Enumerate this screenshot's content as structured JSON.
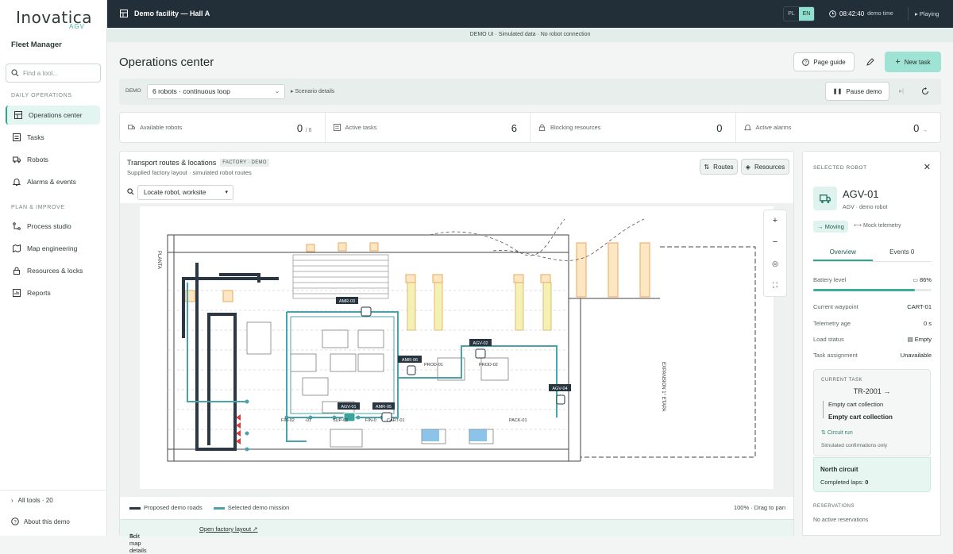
{
  "brand": {
    "name": "Inovatica",
    "sub": "AGV",
    "product": "Fleet Manager"
  },
  "sidebar": {
    "search_placeholder": "Find a tool...",
    "daily_heading": "DAILY OPERATIONS",
    "daily": [
      {
        "label": "Operations center",
        "icon": "layout-icon",
        "active": true
      },
      {
        "label": "Tasks",
        "icon": "list-icon"
      },
      {
        "label": "Robots",
        "icon": "truck-icon"
      },
      {
        "label": "Alarms & events",
        "icon": "bell-icon"
      }
    ],
    "plan_heading": "PLAN & IMPROVE",
    "plan": [
      {
        "label": "Process studio",
        "icon": "flow-icon"
      },
      {
        "label": "Map engineering",
        "icon": "map-icon"
      },
      {
        "label": "Resources & locks",
        "icon": "lock-icon"
      },
      {
        "label": "Reports",
        "icon": "chart-icon"
      }
    ],
    "all_tools": "All tools · 20",
    "about": "About this demo"
  },
  "topbar": {
    "title": "Demo facility — Hall A",
    "lang": [
      "PL",
      "EN"
    ],
    "lang_active": "EN",
    "time": "08:42:40",
    "time_label": "demo time",
    "playing": "Playing"
  },
  "banner": "DEMO UI · Simulated data · No robot connection",
  "page": {
    "title": "Operations center",
    "page_guide": "Page guide",
    "new_task": "New task"
  },
  "toolbar": {
    "demo_label": "DEMO",
    "scenario": "6 robots · continuous loop",
    "scenario_details": "Scenario details",
    "pause": "Pause demo"
  },
  "stats": [
    {
      "label": "Available robots",
      "value": "0",
      "sub": "/ 6"
    },
    {
      "label": "Active tasks",
      "value": "6",
      "sub": ""
    },
    {
      "label": "Blocking resources",
      "value": "0",
      "sub": ""
    },
    {
      "label": "Active alarms",
      "value": "0",
      "sub": "→"
    }
  ],
  "map": {
    "title": "Transport routes & locations",
    "tag": "FACTORY · DEMO",
    "subtitle": "Supplied factory layout · simulated robot routes",
    "routes_btn": "Routes",
    "resources_btn": "Resources",
    "locate": "Locate robot, worksite",
    "legend_proposed": "Proposed demo roads",
    "legend_selected": "Selected demo mission",
    "zoom": "100% · Drag to pan",
    "edit": "Edit map details",
    "open_layout": "Open factory layout ↗",
    "labels": {
      "planta": "PLANTA",
      "expansion": "EXPANSION 1° ETAPA",
      "amr03": "AMR-03",
      "amr06": "AMR-06",
      "amr05": "AMR-05",
      "agv01": "AGV-01",
      "agv02": "AGV-02",
      "agv04": "AGV-04",
      "prod01": "PROD-01",
      "prod02": "PROD-02",
      "pack01": "PACK-01",
      "fin02": "FIN-02",
      "r01": "-01",
      "sup02": "SUP-02",
      "fin": "FIN-0",
      "cart01": "CART-01"
    },
    "colors": {
      "road": "#2b3742",
      "mission": "#4aa3a8",
      "marker": "#263540"
    }
  },
  "robot": {
    "heading": "SELECTED ROBOT",
    "name": "AGV-01",
    "sub": "AGV · demo robot",
    "status": "Moving",
    "telemetry": "Mock telemetry",
    "tabs": [
      "Overview",
      "Events 0"
    ],
    "battery_label": "Battery level",
    "battery_value": "86%",
    "battery_fraction": 0.86,
    "fields": [
      {
        "k": "Current waypoint",
        "v": "CART-01"
      },
      {
        "k": "Telemetry age",
        "v": "0 s"
      },
      {
        "k": "Load status",
        "v": "Empty"
      },
      {
        "k": "Task assignment",
        "v": "Unavailable"
      }
    ],
    "current_task_heading": "CURRENT TASK",
    "task_id": "TR-2001",
    "steps": [
      "Empty cart collection",
      "Empty cart collection"
    ],
    "circuit_run": "Circuit run",
    "sim_note": "Simulated confirmations only",
    "circuit_title": "North circuit",
    "laps_label": "Completed laps:",
    "laps_value": "0",
    "reservations_heading": "RESERVATIONS",
    "reservations_text": "No active reservations"
  }
}
